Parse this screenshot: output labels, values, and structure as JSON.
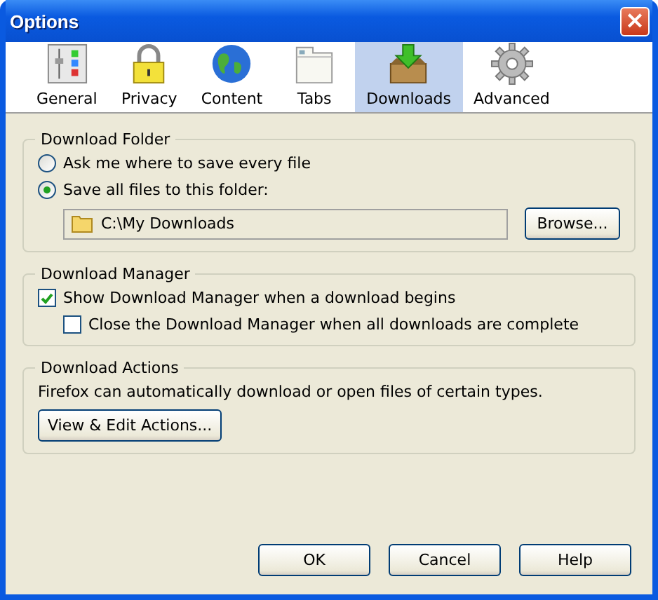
{
  "window": {
    "title": "Options",
    "close": "×"
  },
  "tabs": [
    {
      "label": "General",
      "selected": false
    },
    {
      "label": "Privacy",
      "selected": false
    },
    {
      "label": "Content",
      "selected": false
    },
    {
      "label": "Tabs",
      "selected": false
    },
    {
      "label": "Downloads",
      "selected": true
    },
    {
      "label": "Advanced",
      "selected": false
    }
  ],
  "download_folder": {
    "title": "Download Folder",
    "options": [
      {
        "label": "Ask me where to save every file",
        "selected": false
      },
      {
        "label": "Save all files to this folder:",
        "selected": true
      }
    ],
    "folder_path": "C:\\My Downloads",
    "browse_button": "Browse..."
  },
  "download_manager": {
    "title": "Download Manager",
    "options": [
      {
        "label": "Show Download Manager when a download begins",
        "checked": true,
        "children": [
          {
            "label": "Close the Download Manager when all downloads are complete",
            "checked": false
          }
        ]
      }
    ]
  },
  "download_actions": {
    "title": "Download Actions",
    "description": "Firefox can automatically download or open files of certain types.",
    "button": "View & Edit Actions..."
  },
  "buttons": [
    "OK",
    "Cancel",
    "Help"
  ]
}
